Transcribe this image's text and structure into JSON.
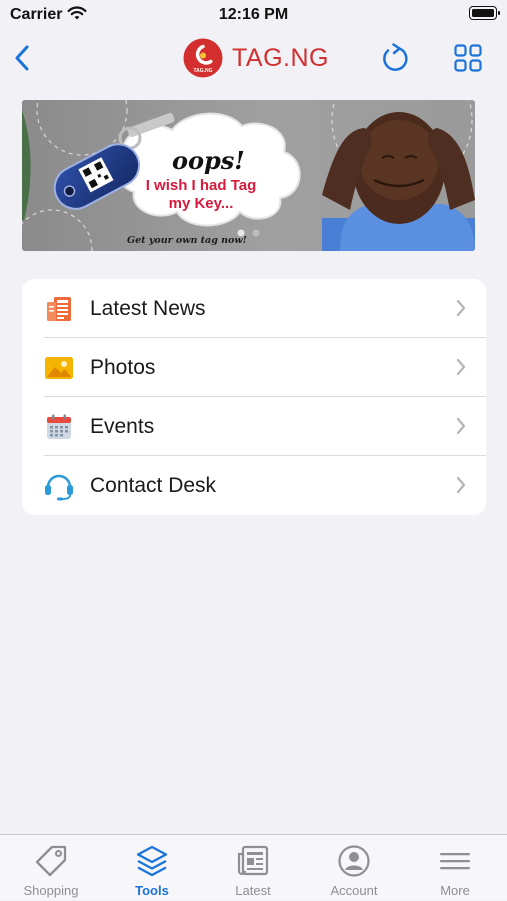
{
  "status_bar": {
    "carrier": "Carrier",
    "time": "12:16 PM"
  },
  "nav": {
    "title": "TAG.NG",
    "logo_text": "TAG.NG",
    "back_icon": "chevron-left-icon",
    "refresh_icon": "refresh-icon",
    "grid_icon": "grid-icon"
  },
  "banner": {
    "headline": "oops!",
    "message": "I wish I had Tag my Key...",
    "tagline": "Get your own tag now!",
    "page_index": 1
  },
  "menu": {
    "items": [
      {
        "label": "Latest News",
        "icon": "newspaper-icon"
      },
      {
        "label": "Photos",
        "icon": "photos-icon"
      },
      {
        "label": "Events",
        "icon": "calendar-icon"
      },
      {
        "label": "Contact Desk",
        "icon": "headset-icon"
      }
    ]
  },
  "tabs": {
    "active": "Tools",
    "items": [
      {
        "label": "Shopping",
        "icon": "tag-icon"
      },
      {
        "label": "Tools",
        "icon": "layers-icon"
      },
      {
        "label": "Latest",
        "icon": "news-icon"
      },
      {
        "label": "Account",
        "icon": "account-icon"
      },
      {
        "label": "More",
        "icon": "menu-icon"
      }
    ]
  },
  "colors": {
    "accent": "#1a73d8",
    "brand": "#d32f2f",
    "background": "#f1f1f6",
    "tab_inactive": "#8e8e93"
  }
}
